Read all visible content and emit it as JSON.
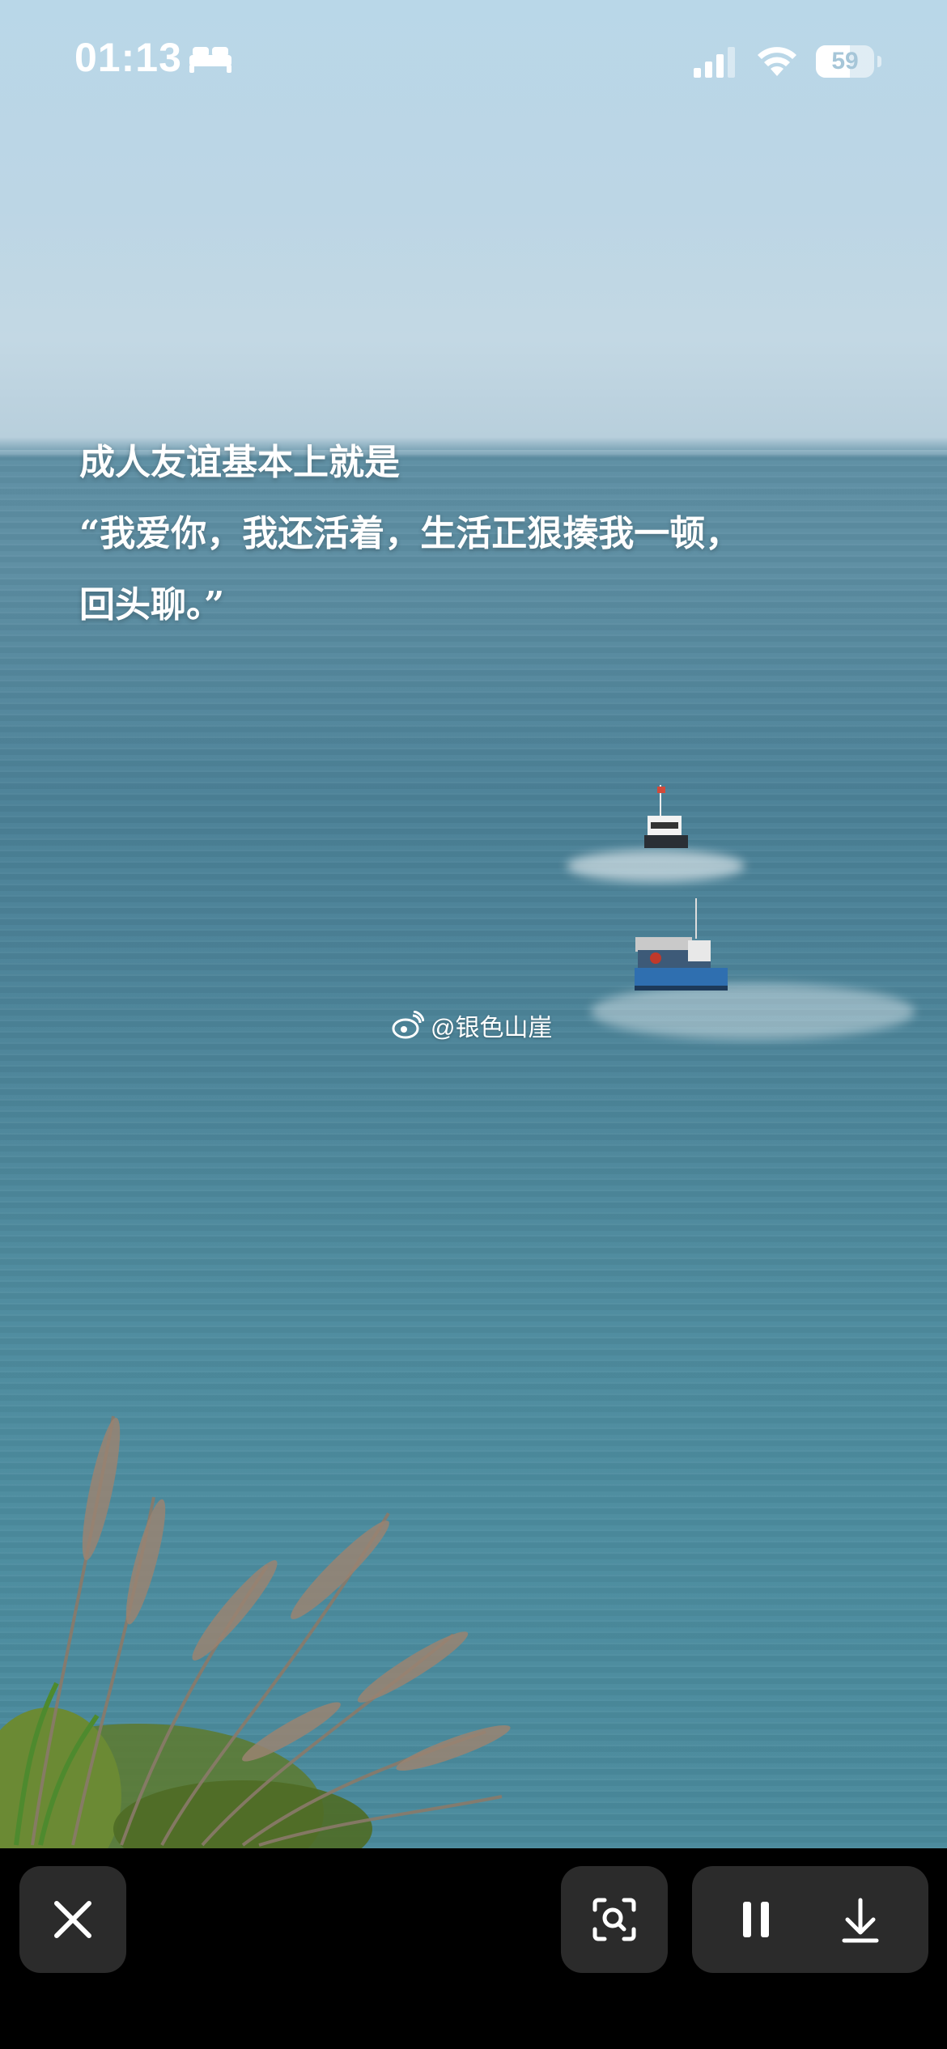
{
  "status_bar": {
    "time": "01:13",
    "battery_level": "59",
    "battery_percent": 59,
    "icons": [
      "bed-icon",
      "signal-icon",
      "wifi-icon",
      "battery-icon"
    ]
  },
  "content": {
    "quote_lines": [
      "成人友谊基本上就是",
      "“我爱你，我还活着，生活正狠揍我一顿，",
      "回头聊。”"
    ],
    "watermark": "@银色山崖"
  },
  "toolbar": {
    "buttons": [
      "close-icon",
      "scan-icon",
      "pause-icon",
      "download-icon"
    ]
  },
  "colors": {
    "sky": "#bcd6e5",
    "sea": "#4c8499",
    "button_bg": "#2b2b2b"
  }
}
